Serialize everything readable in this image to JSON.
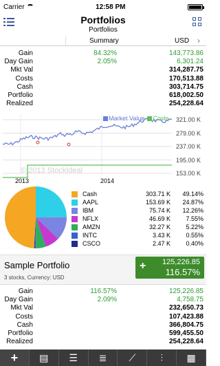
{
  "status": {
    "carrier": "Carrier",
    "time": "12:58 PM"
  },
  "nav": {
    "title": "Portfolios",
    "subtitle": "Portfolios"
  },
  "header": {
    "summary": "Summary",
    "currency": "USD"
  },
  "labels": [
    "Gain",
    "Day Gain",
    "Mkt Val",
    "Costs",
    "Cash",
    "Portfolio",
    "Realized"
  ],
  "summary": {
    "pct": [
      "84.32%",
      "2.05%",
      "",
      "",
      "",
      "",
      ""
    ],
    "values": [
      "143,773.86",
      "6,301.24",
      "314,287.75",
      "170,513.88",
      "303,714.75",
      "618,002.50",
      "254,228.64"
    ]
  },
  "chart": {
    "legend": [
      "Market Value",
      "Costs"
    ],
    "legend_colors": [
      "#6a7fd8",
      "#5cbf5c"
    ],
    "y_ticks": [
      "321.00 K",
      "279.00 K",
      "237.00 K",
      "195.00 K",
      "153.00 K"
    ],
    "x_ticks": [
      "2013",
      "2014"
    ],
    "watermark": "© 2013 StockIdeal"
  },
  "allocation": [
    {
      "name": "Cash",
      "value": "303.71 K",
      "pct": "49.14%",
      "color": "#f5a623",
      "share": 49.14
    },
    {
      "name": "AAPL",
      "value": "153.69 K",
      "pct": "24.87%",
      "color": "#2ed0e8",
      "share": 24.87
    },
    {
      "name": "IBM",
      "value": "75.74 K",
      "pct": "12.26%",
      "color": "#7b84e0",
      "share": 12.26
    },
    {
      "name": "NFLX",
      "value": "46.69 K",
      "pct": "7.55%",
      "color": "#c43ad1",
      "share": 7.55
    },
    {
      "name": "AMZN",
      "value": "32.27 K",
      "pct": "5.22%",
      "color": "#2fae5e",
      "share": 5.22
    },
    {
      "name": "INTC",
      "value": "3.43 K",
      "pct": "0.55%",
      "color": "#3b5fd0",
      "share": 0.55
    },
    {
      "name": "CSCO",
      "value": "2.47 K",
      "pct": "0.40%",
      "color": "#222a8a",
      "share": 0.4
    }
  ],
  "portfolio": {
    "name": "Sample Portfolio",
    "info": "3 stocks, Currency: USD",
    "gain_value": "125,226.85",
    "gain_pct": "116.57%",
    "pct": [
      "116.57%",
      "2.09%",
      "",
      "",
      "",
      "",
      ""
    ],
    "values": [
      "125,226.85",
      "4,758.75",
      "232,650.73",
      "107,423.88",
      "366,804.75",
      "599,455.50",
      "254,228.64"
    ]
  },
  "tabs": [
    "+",
    "doc",
    "list",
    "align",
    "chart",
    "sliders",
    "grid"
  ]
}
